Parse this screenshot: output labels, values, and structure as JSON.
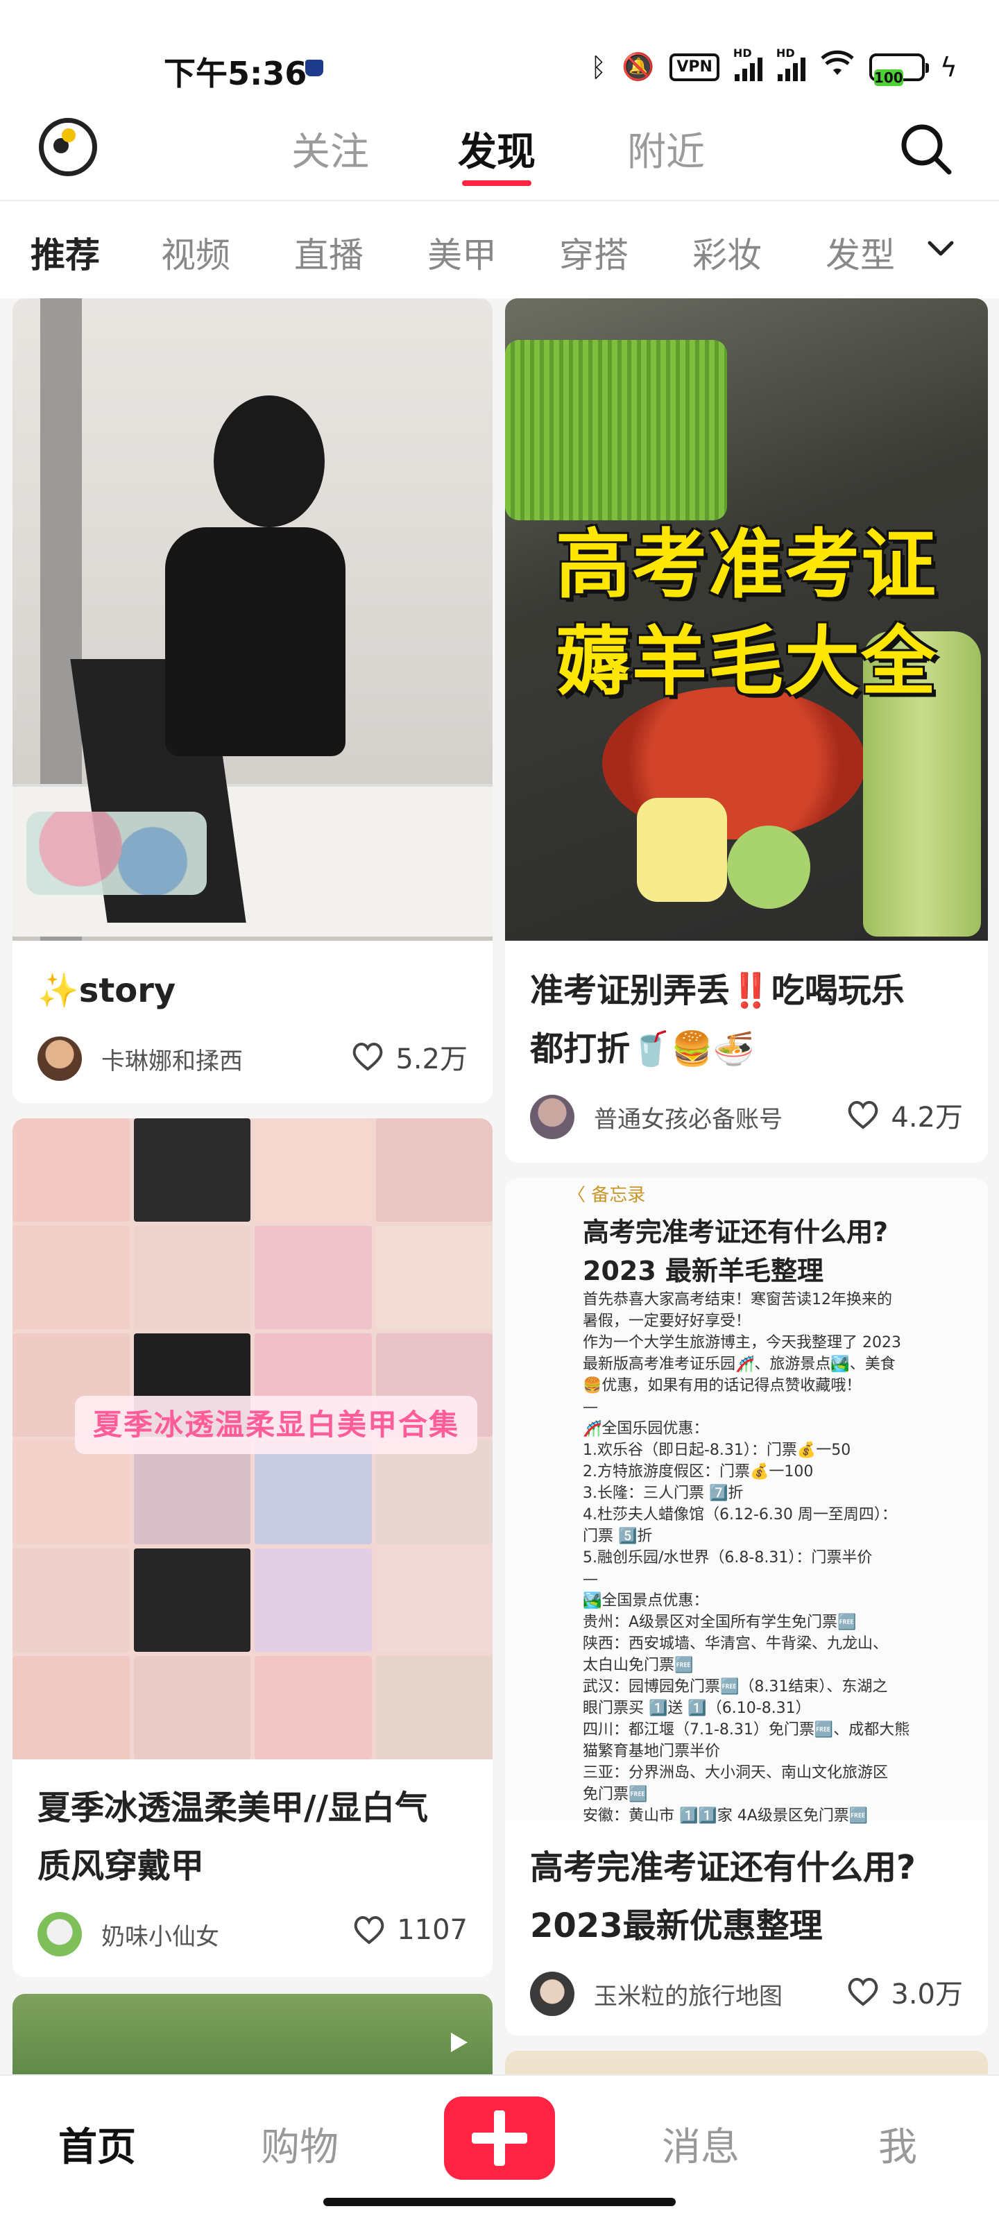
{
  "status_bar": {
    "time": "下午5:36",
    "vpn": "VPN",
    "hd1": "HD",
    "hd2": "HD",
    "battery": "100"
  },
  "top_nav": {
    "tabs": [
      {
        "label": "关注"
      },
      {
        "label": "发现",
        "active": true
      },
      {
        "label": "附近"
      }
    ]
  },
  "categories": [
    "推荐",
    "视频",
    "直播",
    "美甲",
    "穿搭",
    "彩妆",
    "发型"
  ],
  "feed": {
    "cards": [
      {
        "title": "✨story",
        "author": "卡琳娜和揉西",
        "likes": "5.2万"
      },
      {
        "overlay_line1": "高考准考证",
        "overlay_line2": "薅羊毛大全",
        "title_line1": "准考证别弄丢‼️吃喝玩乐",
        "title_line2": "都打折🥤🍔🍜",
        "author": "普通女孩必备账号",
        "likes": "4.2万"
      },
      {
        "banner": "夏季冰透温柔显白美甲合集",
        "title_line1": "夏季冰透温柔美甲//显白气",
        "title_line2": "质风穿戴甲",
        "author": "奶味小仙女",
        "likes": "1107"
      },
      {
        "note_back": "〈 备忘录",
        "note_heading1": "高考完准考证还有什么用?",
        "note_heading2": "2023 最新羊毛整理",
        "note_body": "首先恭喜大家高考结束！寒窗苦读12年换来的\n暑假，一定要好好享受！\n作为一个大学生旅游博主，今天我整理了 2023\n最新版高考准考证乐园🎢、旅游景点🏞️、美食\n🍔优惠，如果有用的话记得点赞收藏哦！\n—\n🎢全国乐园优惠：\n1.欢乐谷（即日起-8.31）：门票💰一50\n2.方特旅游度假区：门票💰一100\n3.长隆：三人门票 7️⃣折\n4.杜莎夫人蜡像馆（6.12-6.30 周一至周四）：\n门票 5️⃣折\n5.融创乐园/水世界（6.8-8.31）：门票半价\n—\n🏞️全国景点优惠：\n贵州：A级景区对全国所有学生免门票🆓\n陕西：西安城墙、华清宫、牛背梁、九龙山、\n太白山免门票🆓\n武汉：园博园免门票🆓（8.31结束）、东湖之\n眼门票买 1️⃣送 1️⃣（6.10-8.31）\n四川：都江堰（7.1-8.31）免门票🆓、成都大熊\n猫繁育基地门票半价\n三亚：分界洲岛、大小洞天、南山文化旅游区\n免门票🆓\n安徽：黄山市 1️⃣1️⃣家 4A级景区免门票🆓",
        "title_line1": "高考完准考证还有什么用?",
        "title_line2": "2023最新优惠整理",
        "author": "玉米粒的旅行地图",
        "likes": "3.0万"
      }
    ]
  },
  "bottom_tabs": {
    "home": "首页",
    "shop": "购物",
    "messages": "消息",
    "me": "我"
  },
  "colors": {
    "accent": "#ff2442",
    "logo_dot": "#f2c200"
  }
}
